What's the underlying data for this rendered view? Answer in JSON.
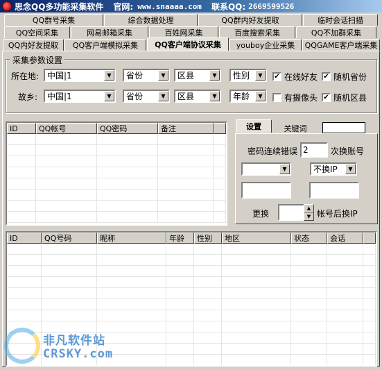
{
  "title": {
    "app": "思念QQ多功能采集软件",
    "site_label": "官网:",
    "site_url": "www.snaaaa.com",
    "qq_label": "联系QQ:",
    "qq_number": "2669599526"
  },
  "tabs": {
    "row1": [
      "QQ群号采集",
      "综合数据处理",
      "QQ群内好友提取",
      "临时会话扫描"
    ],
    "row2": [
      "QQ空间采集",
      "网易邮箱采集",
      "百姓网采集",
      "百度搜索采集",
      "QQ不加群采集"
    ],
    "row3": [
      "QQ内好友提取",
      "QQ客户端模拟采集",
      "QQ客户端协议采集",
      "youboy企业采集",
      "QQGAME客户端采集"
    ],
    "active": "QQ客户端协议采集"
  },
  "params": {
    "group_title": "采集参数设置",
    "location_label": "所在地:",
    "hometown_label": "故乡:",
    "location": {
      "country": "中国|1",
      "province": "省份",
      "county": "区县",
      "gender": "性别"
    },
    "hometown": {
      "country": "中国|1",
      "province": "省份",
      "county": "区县",
      "age": "年龄"
    },
    "checks": [
      {
        "label": "在线好友",
        "checked": true
      },
      {
        "label": "随机省份",
        "checked": true
      },
      {
        "label": "有摄像头",
        "checked": false
      },
      {
        "label": "随机区县",
        "checked": true
      }
    ]
  },
  "accounts_table": {
    "headers": [
      "ID",
      "QQ帐号",
      "QQ密码",
      "备注"
    ]
  },
  "settings_panel": {
    "tabs": [
      "设置",
      "关键词"
    ],
    "keyword_value": "",
    "pwd_error_label": "密码连续错误",
    "pwd_error_value": "2",
    "switch_account_label": "次换账号",
    "ip_select_value": "",
    "ip_mode": "不换IP",
    "field1": "",
    "field2": "",
    "change_label": "更换",
    "change_value": "",
    "change_suffix": "帐号后换IP"
  },
  "results_table": {
    "headers": [
      "ID",
      "QQ号码",
      "昵称",
      "年龄",
      "性别",
      "地区",
      "状态",
      "会话"
    ]
  },
  "watermark": {
    "line1": "非凡软件站",
    "line2": "CRSKY.com"
  },
  "colors": {
    "face": "#d4d0c8",
    "title_start": "#0a246a",
    "title_end": "#a6caf0"
  }
}
